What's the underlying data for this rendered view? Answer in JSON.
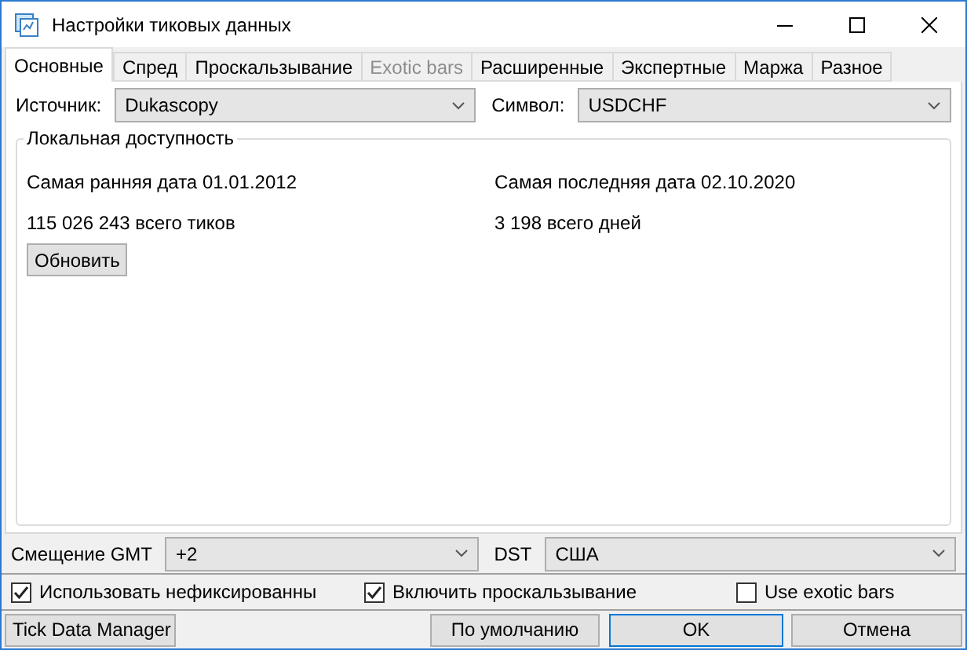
{
  "window": {
    "title": "Настройки тиковых данных"
  },
  "tabs": [
    {
      "label": "Основные",
      "selected": true,
      "disabled": false
    },
    {
      "label": "Спред",
      "selected": false,
      "disabled": false
    },
    {
      "label": "Проскальзывание",
      "selected": false,
      "disabled": false
    },
    {
      "label": "Exotic bars",
      "selected": false,
      "disabled": true
    },
    {
      "label": "Расширенные",
      "selected": false,
      "disabled": false
    },
    {
      "label": "Экспертные",
      "selected": false,
      "disabled": false
    },
    {
      "label": "Маржа",
      "selected": false,
      "disabled": false
    },
    {
      "label": "Разное",
      "selected": false,
      "disabled": false
    }
  ],
  "source": {
    "label": "Источник:",
    "value": "Dukascopy"
  },
  "symbol": {
    "label": "Символ:",
    "value": "USDCHF"
  },
  "local_availability": {
    "title": "Локальная доступность",
    "earliest": "Самая ранняя дата 01.01.2012",
    "latest": "Самая последняя дата 02.10.2020",
    "ticks": "115 026 243 всего тиков",
    "days": "3 198 всего дней",
    "refresh_button": "Обновить"
  },
  "gmt_offset": {
    "label": "Смещение GMT",
    "value": "+2"
  },
  "dst": {
    "label": "DST",
    "value": "США"
  },
  "checkboxes": [
    {
      "label": "Использовать нефиксированны",
      "checked": true
    },
    {
      "label": "Включить проскальзывание",
      "checked": true
    },
    {
      "label": "Use exotic bars",
      "checked": false
    }
  ],
  "buttons": {
    "tick_data_manager": "Tick Data Manager",
    "defaults": "По умолчанию",
    "ok": "OK",
    "cancel": "Отмена"
  }
}
